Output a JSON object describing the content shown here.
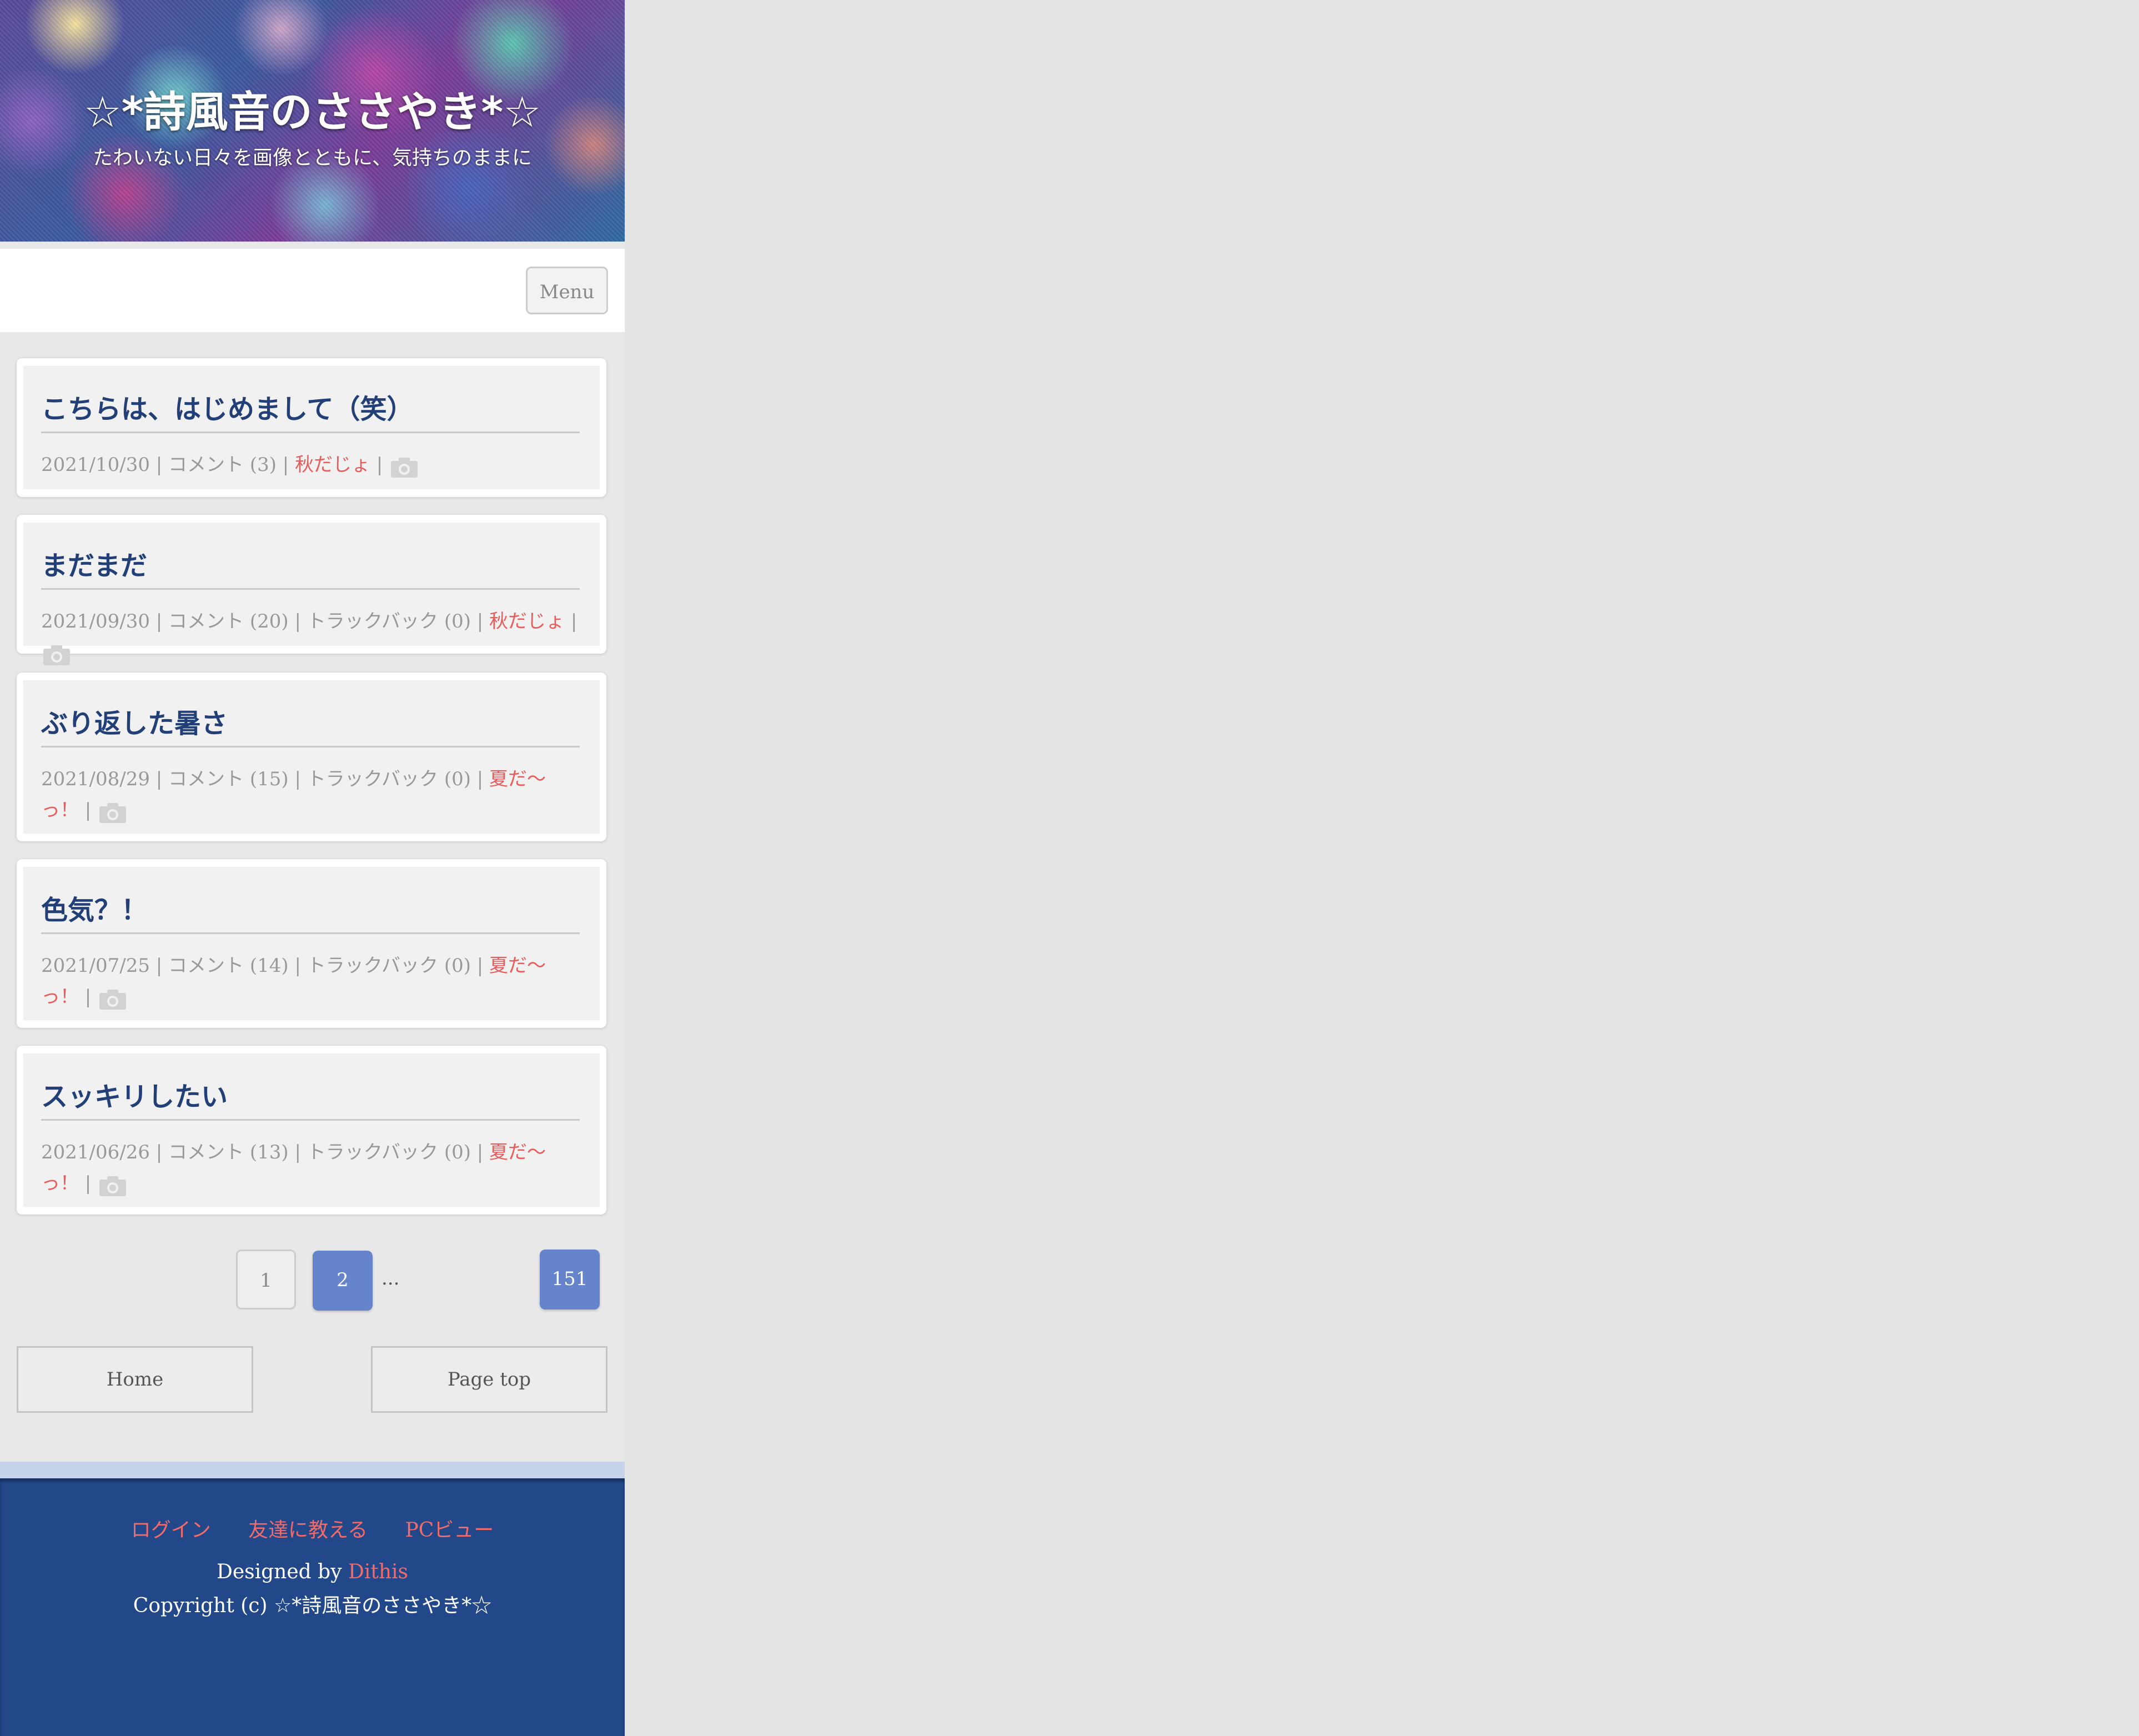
{
  "header": {
    "title": "☆*詩風音のささやき*☆",
    "subtitle": "たわいない日々を画像とともに、気持ちのままに"
  },
  "nav": {
    "menu_label": "Menu"
  },
  "posts": [
    {
      "title": "こちらは、はじめまして（笑）",
      "meta_prefix": "2021/10/30 | コメント (3) | ",
      "category": "秋だじょ",
      "meta_suffix": " |"
    },
    {
      "title": "まだまだ",
      "meta_prefix": "2021/09/30 | コメント (20) | トラックバック (0) | ",
      "category": "秋だじょ",
      "meta_suffix": " |"
    },
    {
      "title": "ぶり返した暑さ",
      "meta_prefix": "2021/08/29 | コメント (15) | トラックバック (0) | ",
      "category": "夏だ～っ！",
      "meta_suffix": " |"
    },
    {
      "title": "色気？！",
      "meta_prefix": "2021/07/25 | コメント (14) | トラックバック (0) | ",
      "category": "夏だ～っ！",
      "meta_suffix": " |"
    },
    {
      "title": "スッキリしたい",
      "meta_prefix": "2021/06/26 | コメント (13) | トラックバック (0) | ",
      "category": "夏だ～っ！",
      "meta_suffix": " |"
    }
  ],
  "pager": {
    "first": "1",
    "current": "2",
    "ellipsis": "...",
    "last": "151"
  },
  "bottom_nav": {
    "home": "Home",
    "page_top": "Page top"
  },
  "footer": {
    "links": [
      "ログイン",
      "友達に教える",
      "PCビュー"
    ],
    "designed_by": "Designed by ",
    "designer": "Dithis",
    "copyright": "Copyright (c) ☆*詩風音のささやき*☆"
  },
  "colors": {
    "title_blue": "#223f78",
    "category_red": "#e85c5c",
    "pager_active": "#6584cb",
    "footer_bg": "#23488a"
  },
  "icons": {
    "photo": "camera-icon"
  }
}
